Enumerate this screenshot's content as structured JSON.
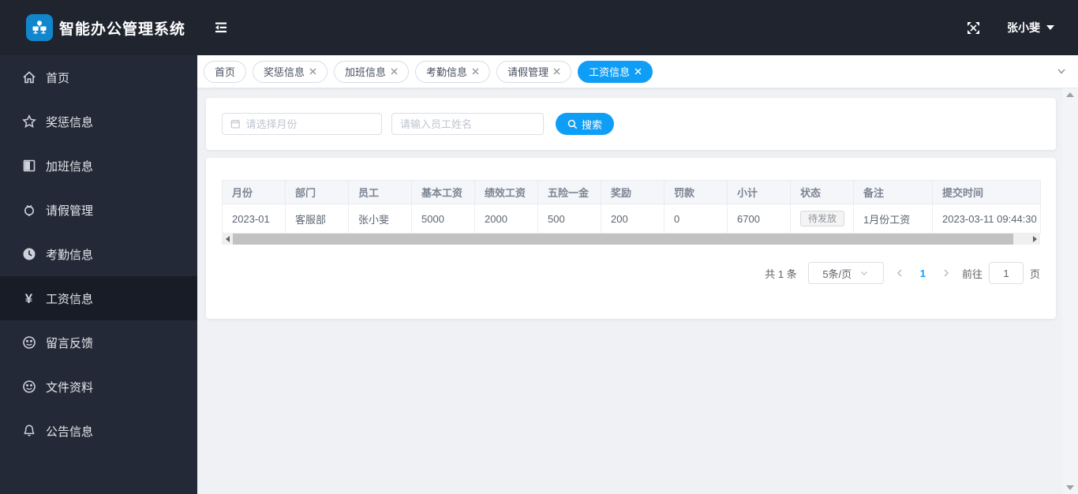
{
  "app": {
    "title": "智能办公管理系统",
    "user_name": "张小斐"
  },
  "colors": {
    "accent_blue": "#0f9ef6",
    "header_bg": "#1f242e",
    "sidebar_bg": "#232937",
    "sidebar_active_bg": "#171c26",
    "content_bg": "#eff1f4",
    "tag_text": "#8f939a"
  },
  "icons": {
    "logo": "org-sitemap",
    "collapse": "hamburger",
    "fullscreen": "expand-arrows",
    "user_caret": "caret-down",
    "month_field": "calendar",
    "search": "magnifier",
    "tab_close": "x-cross"
  },
  "sidebar": {
    "items": [
      {
        "label": "首页",
        "icon": "home-icon",
        "active": false
      },
      {
        "label": "奖惩信息",
        "icon": "star-icon",
        "active": false
      },
      {
        "label": "加班信息",
        "icon": "notebook-icon",
        "active": false
      },
      {
        "label": "请假管理",
        "icon": "stopwatch-icon",
        "active": false
      },
      {
        "label": "考勤信息",
        "icon": "clock-icon",
        "active": false
      },
      {
        "label": "工资信息",
        "icon": "yen-icon",
        "active": true
      },
      {
        "label": "留言反馈",
        "icon": "smiley-icon",
        "active": false
      },
      {
        "label": "文件资料",
        "icon": "smiley-icon",
        "active": false
      },
      {
        "label": "公告信息",
        "icon": "bell-icon",
        "active": false
      }
    ]
  },
  "tabs": [
    {
      "label": "首页",
      "closable": false,
      "active": false
    },
    {
      "label": "奖惩信息",
      "closable": true,
      "active": false
    },
    {
      "label": "加班信息",
      "closable": true,
      "active": false
    },
    {
      "label": "考勤信息",
      "closable": true,
      "active": false
    },
    {
      "label": "请假管理",
      "closable": true,
      "active": false
    },
    {
      "label": "工资信息",
      "closable": true,
      "active": true
    }
  ],
  "search": {
    "month_placeholder": "请选择月份",
    "name_placeholder": "请输入员工姓名",
    "button_label": "搜索"
  },
  "table": {
    "columns": [
      "月份",
      "部门",
      "员工",
      "基本工资",
      "绩效工资",
      "五险一金",
      "奖励",
      "罚款",
      "小计",
      "状态",
      "备注",
      "提交时间"
    ],
    "rows": [
      [
        "2023-01",
        "客服部",
        "张小斐",
        "5000",
        "2000",
        "500",
        "200",
        "0",
        "6700",
        "待发放",
        "1月份工资",
        "2023-03-11 09:44:30"
      ]
    ]
  },
  "pagination": {
    "total_label": "共 1 条",
    "page_size": "5条/页",
    "current_page": "1",
    "goto_label": "前往",
    "goto_value": "1",
    "page_unit": "页"
  }
}
